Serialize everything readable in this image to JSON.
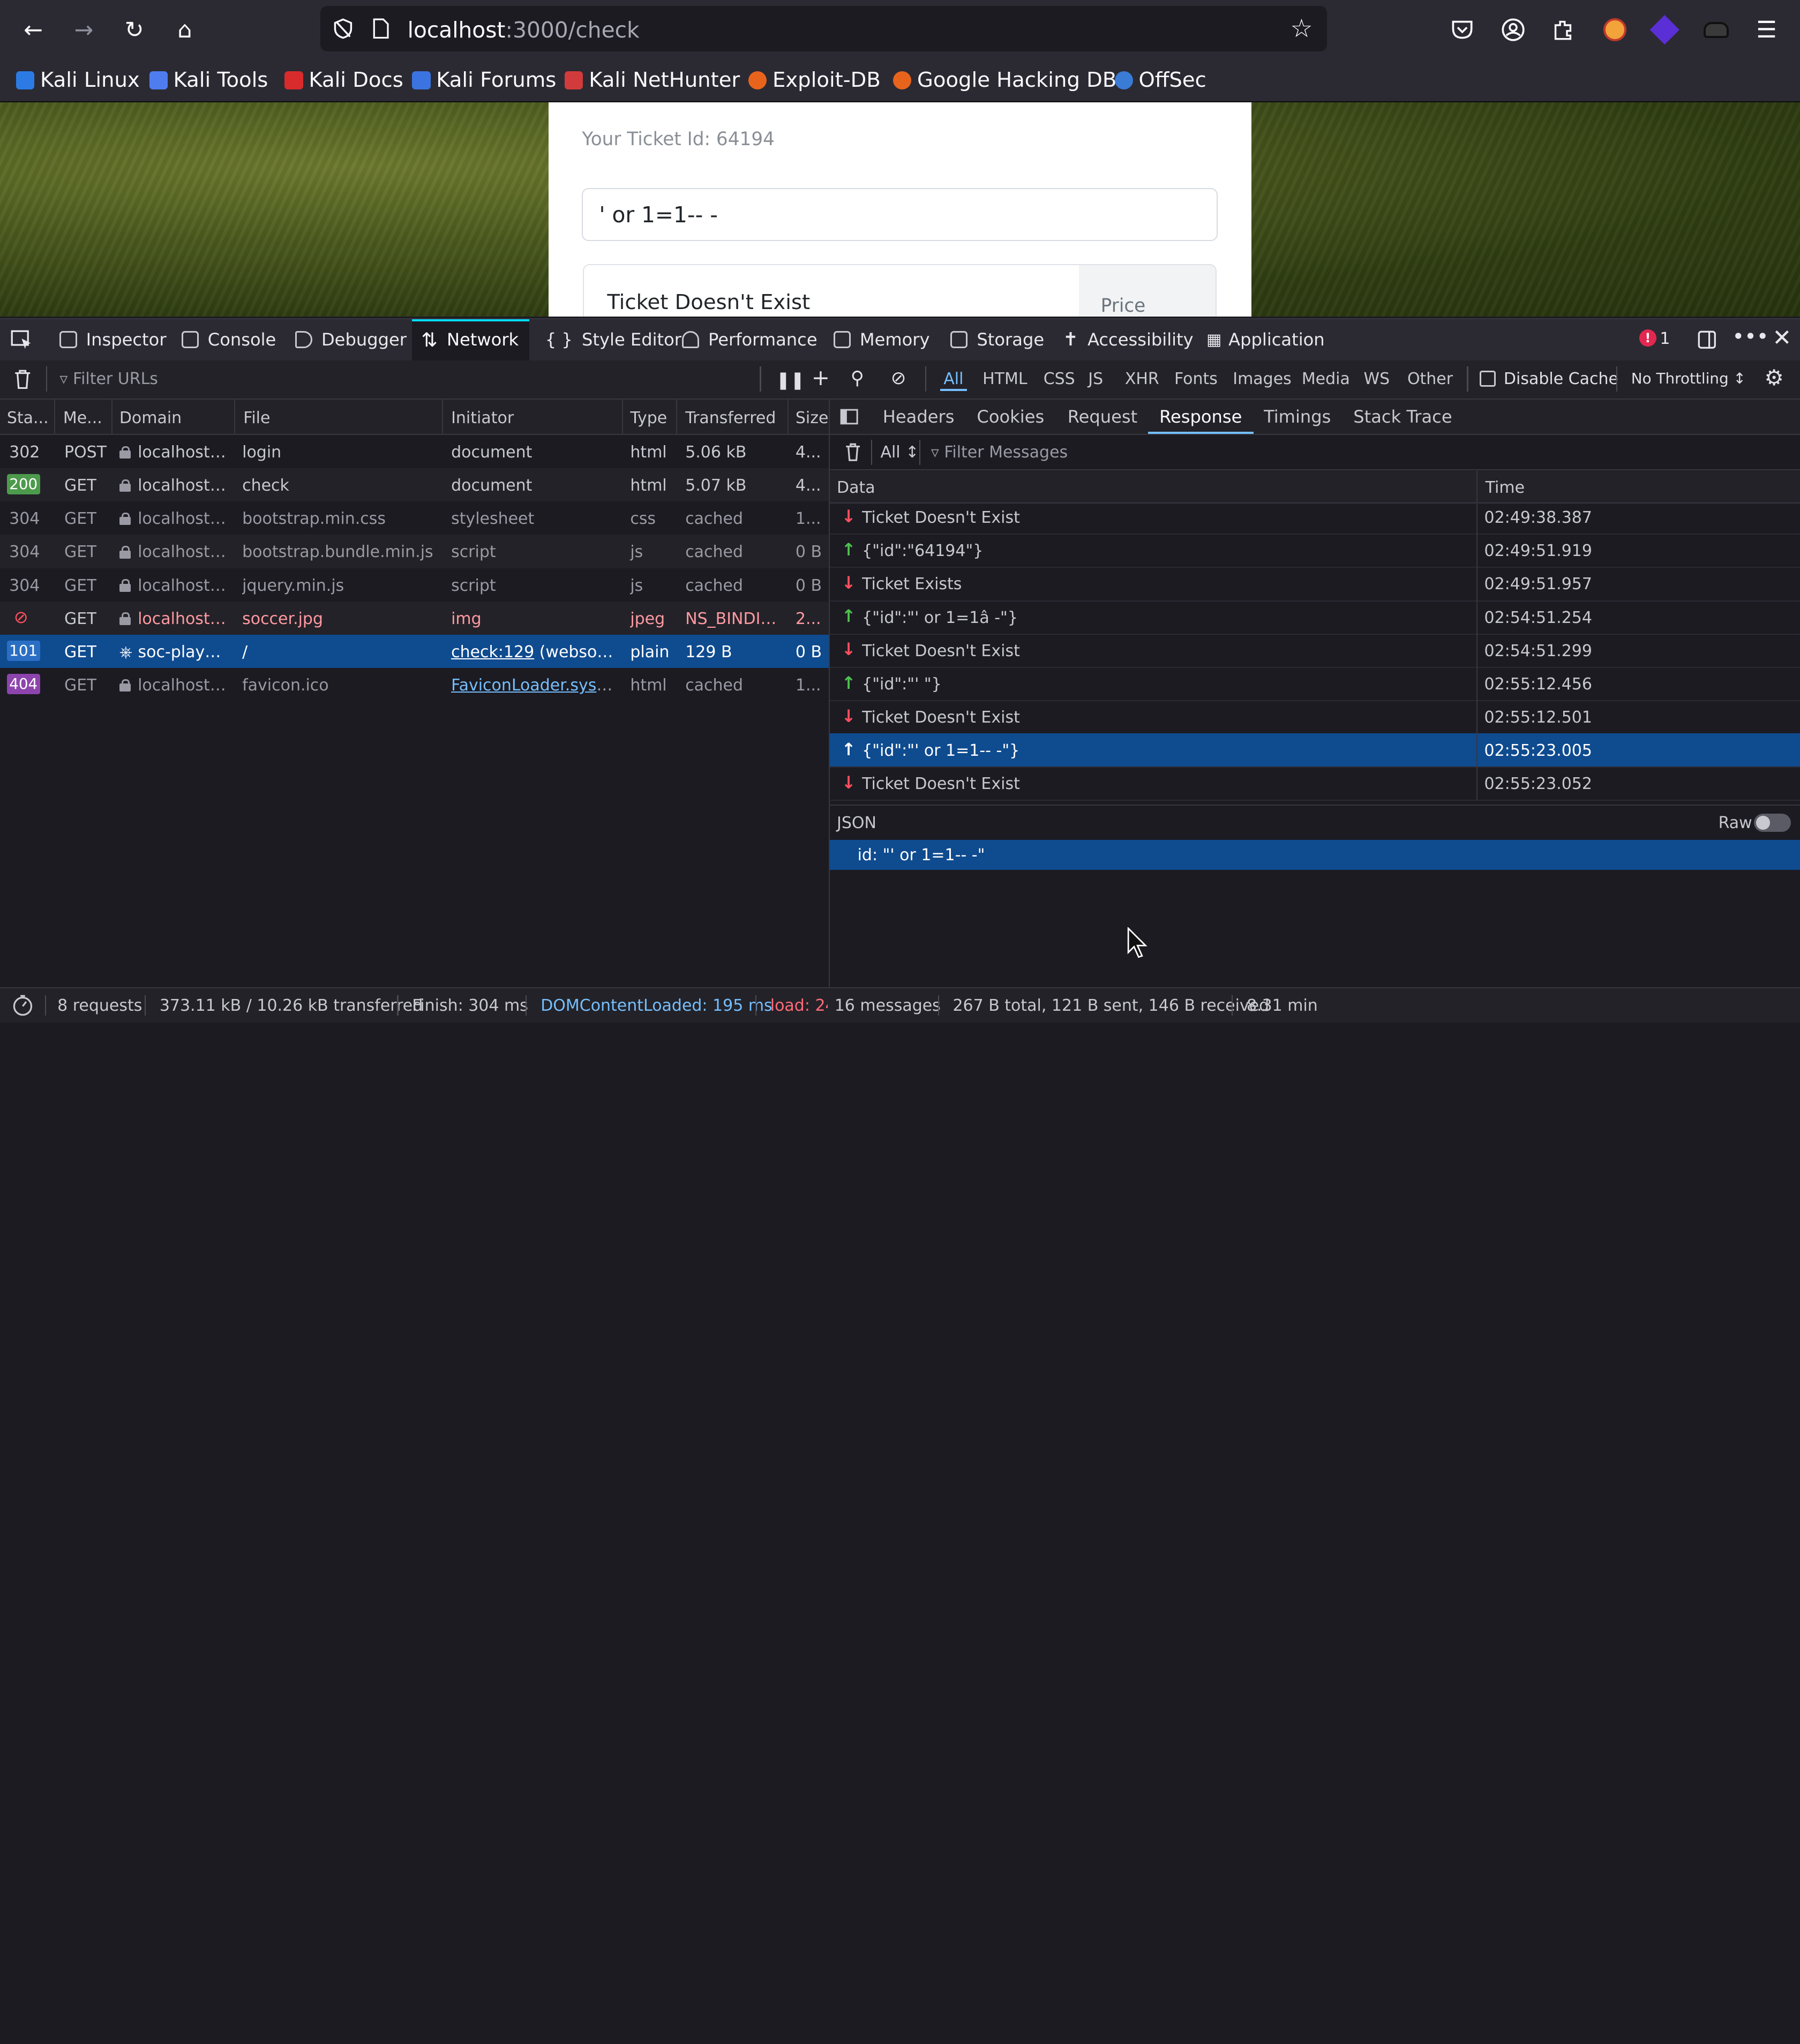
{
  "browser": {
    "url_host": "localhost",
    "url_path": ":3000/check",
    "bookmarks": [
      "Kali Linux",
      "Kali Tools",
      "Kali Docs",
      "Kali Forums",
      "Kali NetHunter",
      "Exploit-DB",
      "Google Hacking DB",
      "OffSec"
    ]
  },
  "page": {
    "ticket_id_label": "Your Ticket Id: 64194",
    "input_value": "' or 1=1-- -",
    "result_text": "Ticket Doesn't Exist",
    "price_header": "Price"
  },
  "devtools": {
    "tabs": [
      "Inspector",
      "Console",
      "Debugger",
      "Network",
      "Style Editor",
      "Performance",
      "Memory",
      "Storage",
      "Accessibility",
      "Application"
    ],
    "active_tab": "Network",
    "error_count": "1",
    "filter_placeholder": "Filter URLs",
    "type_filters": [
      "All",
      "HTML",
      "CSS",
      "JS",
      "XHR",
      "Fonts",
      "Images",
      "Media",
      "WS",
      "Other"
    ],
    "disable_cache_label": "Disable Cache",
    "throttling_label": "No Throttling ↕",
    "columns": [
      "Sta...",
      "Me...",
      "Domain",
      "File",
      "Initiator",
      "Type",
      "Transferred",
      "Size"
    ],
    "requests": [
      {
        "status": "302",
        "method": "POST",
        "domain": "localhost:...",
        "file": "login",
        "initiator": "document",
        "type": "html",
        "transferred": "5.06 kB",
        "size": "4..."
      },
      {
        "status": "200",
        "method": "GET",
        "domain": "localhost:...",
        "file": "check",
        "initiator": "document",
        "type": "html",
        "transferred": "5.07 kB",
        "size": "4..."
      },
      {
        "status": "304",
        "method": "GET",
        "domain": "localhost:...",
        "file": "bootstrap.min.css",
        "initiator": "stylesheet",
        "type": "css",
        "transferred": "cached",
        "size": "1..."
      },
      {
        "status": "304",
        "method": "GET",
        "domain": "localhost:...",
        "file": "bootstrap.bundle.min.js",
        "initiator": "script",
        "type": "js",
        "transferred": "cached",
        "size": "0 B"
      },
      {
        "status": "304",
        "method": "GET",
        "domain": "localhost:...",
        "file": "jquery.min.js",
        "initiator": "script",
        "type": "js",
        "transferred": "cached",
        "size": "0 B"
      },
      {
        "status": "⊘",
        "method": "GET",
        "domain": "localhost:...",
        "file": "soccer.jpg",
        "initiator": "img",
        "type": "jpeg",
        "transferred": "NS_BINDIN...",
        "size": "2..."
      },
      {
        "status": "101",
        "method": "GET",
        "domain": "soc-player...",
        "file": "/",
        "initiator": "check:129",
        "initiator_extra": "(websocket)",
        "type": "plain",
        "transferred": "129 B",
        "size": "0 B"
      },
      {
        "status": "404",
        "method": "GET",
        "domain": "localhost:...",
        "file": "favicon.ico",
        "initiator": "FaviconLoader.sys.mj...",
        "type": "html",
        "transferred": "cached",
        "size": "1..."
      }
    ],
    "response_tabs": [
      "Headers",
      "Cookies",
      "Request",
      "Response",
      "Timings",
      "Stack Trace"
    ],
    "active_response_tab": "Response",
    "msg_filter_all": "All ↕",
    "msg_filter_placeholder": "Filter Messages",
    "msg_columns": [
      "Data",
      "Time"
    ],
    "messages": [
      {
        "dir": "down",
        "data": "Ticket Doesn't Exist",
        "time": "02:49:38.387"
      },
      {
        "dir": "up",
        "data": "{\"id\":\"64194\"}",
        "time": "02:49:51.919"
      },
      {
        "dir": "down",
        "data": "Ticket Exists",
        "time": "02:49:51.957"
      },
      {
        "dir": "up",
        "data": "{\"id\":\"' or 1=1â -\"}",
        "time": "02:54:51.254"
      },
      {
        "dir": "down",
        "data": "Ticket Doesn't Exist",
        "time": "02:54:51.299"
      },
      {
        "dir": "up",
        "data": "{\"id\":\"' \"}",
        "time": "02:55:12.456"
      },
      {
        "dir": "down",
        "data": "Ticket Doesn't Exist",
        "time": "02:55:12.501"
      },
      {
        "dir": "up",
        "data": "{\"id\":\"' or 1=1-- -\"}",
        "time": "02:55:23.005"
      },
      {
        "dir": "down",
        "data": "Ticket Doesn't Exist",
        "time": "02:55:23.052"
      }
    ],
    "json_label": "JSON",
    "raw_label": "Raw",
    "json_value": "id: \"' or 1=1-- -\"",
    "statusbar": {
      "requests": "8 requests",
      "transferred": "373.11 kB / 10.26 kB transferred",
      "finish": "Finish: 304 ms",
      "dcl": "DOMContentLoaded: 195 ms",
      "load": "load: 24",
      "messages": "16 messages",
      "bytes": "267 B total, 121 B sent, 146 B received",
      "duration": "8.31 min"
    }
  },
  "colors": {
    "accent": "#75bfff",
    "selected_row": "#0f4b8f",
    "up_arrow": "#4dc24d",
    "down_arrow": "#ff4f5e"
  }
}
